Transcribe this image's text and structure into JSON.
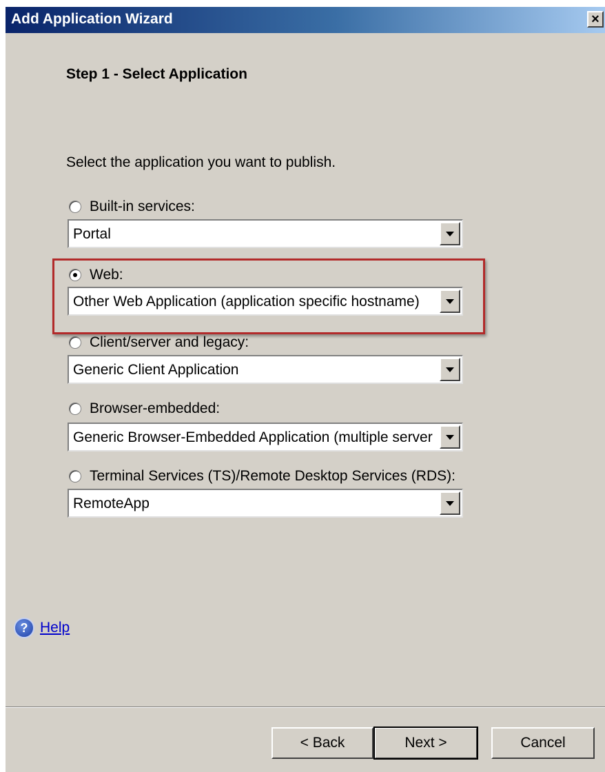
{
  "window": {
    "title": "Add Application Wizard",
    "close_glyph": "×"
  },
  "step": {
    "title": "Step 1 - Select Application",
    "instruction": "Select the application you want to publish."
  },
  "options": [
    {
      "label": "Built-in services:",
      "checked": false,
      "combo_value": "Portal"
    },
    {
      "label": "Web:",
      "checked": true,
      "combo_value": "Other Web Application (application specific hostname)"
    },
    {
      "label": "Client/server and legacy:",
      "checked": false,
      "combo_value": "Generic Client Application"
    },
    {
      "label": "Browser-embedded:",
      "checked": false,
      "combo_value": "Generic Browser-Embedded Application (multiple server"
    },
    {
      "label": "Terminal Services (TS)/Remote Desktop Services (RDS):",
      "checked": false,
      "combo_value": "RemoteApp"
    }
  ],
  "help": {
    "icon": "help-question-icon",
    "icon_glyph": "?",
    "label": "Help"
  },
  "buttons": {
    "back": "< Back",
    "next": "Next >",
    "cancel": "Cancel"
  },
  "colors": {
    "highlight": "#b22a2a",
    "link": "#0000cc"
  }
}
